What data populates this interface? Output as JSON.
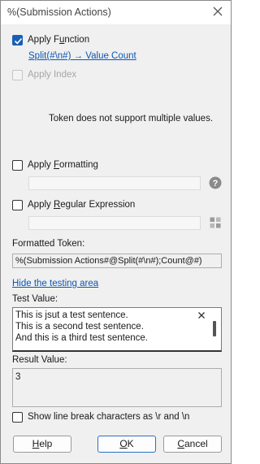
{
  "window": {
    "title": "%(Submission Actions)"
  },
  "apply_function": {
    "label_pre": "Apply F",
    "label_u": "u",
    "label_post": "nction",
    "checked": true,
    "link": "Split(#\\n#) → Value Count"
  },
  "apply_index": {
    "label_pre": "Apply ",
    "label_u": "I",
    "label_post": "ndex",
    "checked": false,
    "disabled": true
  },
  "notice": "Token does not support multiple values.",
  "apply_formatting": {
    "label_pre": "Apply ",
    "label_u": "F",
    "label_post": "ormatting",
    "checked": false,
    "value": "",
    "icon": "help-icon"
  },
  "apply_regex": {
    "label_pre": "Apply ",
    "label_u": "R",
    "label_post": "egular Expression",
    "checked": false,
    "value": "",
    "icon": "regex-builder-icon"
  },
  "formatted_token": {
    "label": "Formatted Token:",
    "value": "%(Submission Actions#@Split(#\\n#);Count@#)"
  },
  "testing": {
    "toggle_link": "Hide the testing area",
    "test_label": "Test Value:",
    "test_lines": [
      "This is jsut a test sentence.",
      "This is a second test sentence.",
      "And this is a third test sentence."
    ],
    "result_label": "Result Value:",
    "result_value": "3",
    "linebreak_label": "Show line break characters as \\r and \\n",
    "linebreak_checked": false
  },
  "buttons": {
    "help_pre": "",
    "help_u": "H",
    "help_post": "elp",
    "ok_pre": "",
    "ok_u": "O",
    "ok_post": "K",
    "cancel_pre": "",
    "cancel_u": "C",
    "cancel_post": "ancel"
  },
  "colors": {
    "accent": "#1a5fb4",
    "link": "#0b57b4",
    "dialog_bg": "#f0f0f0"
  }
}
